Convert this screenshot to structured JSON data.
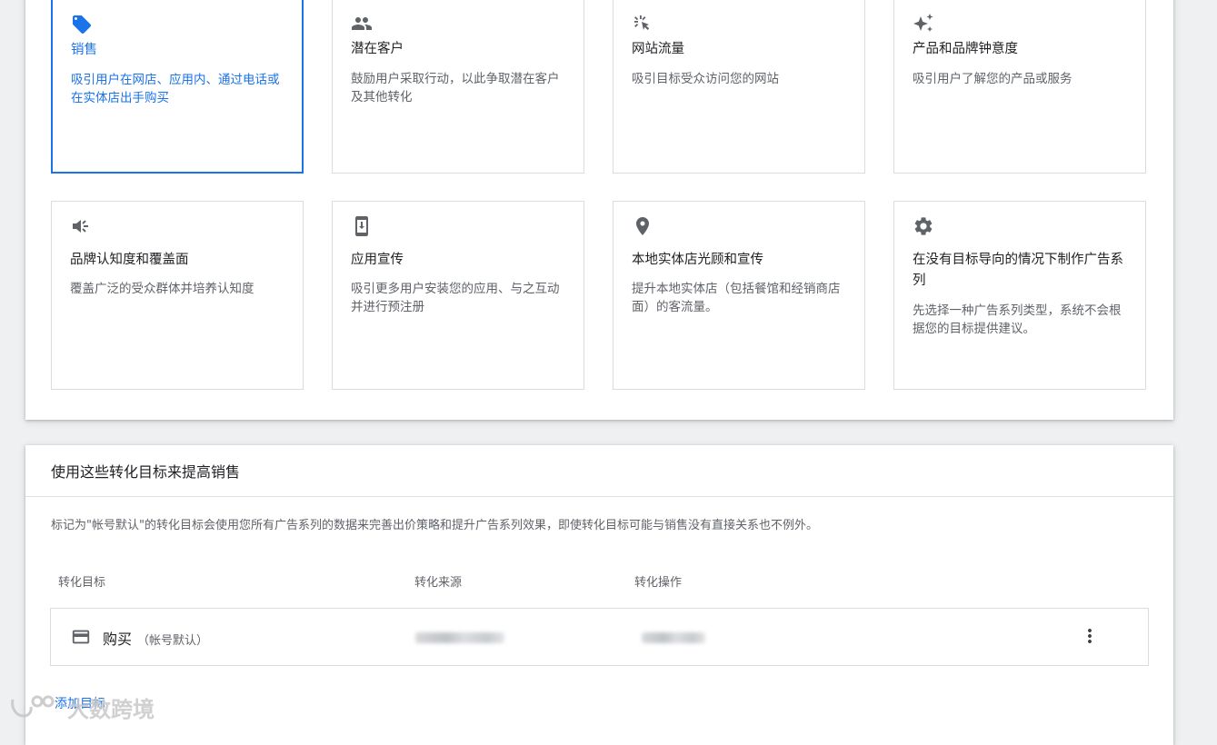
{
  "goals": [
    {
      "title": "销售",
      "desc": "吸引用户在网店、应用内、通过电话或在实体店出手购买",
      "icon": "tag-icon",
      "selected": true
    },
    {
      "title": "潜在客户",
      "desc": "鼓励用户采取行动，以此争取潜在客户及其他转化",
      "icon": "people-icon",
      "selected": false
    },
    {
      "title": "网站流量",
      "desc": "吸引目标受众访问您的网站",
      "icon": "cursor-click-icon",
      "selected": false
    },
    {
      "title": "产品和品牌钟意度",
      "desc": "吸引用户了解您的产品或服务",
      "icon": "sparkle-icon",
      "selected": false
    },
    {
      "title": "品牌认知度和覆盖面",
      "desc": "覆盖广泛的受众群体并培养认知度",
      "icon": "megaphone-icon",
      "selected": false
    },
    {
      "title": "应用宣传",
      "desc": "吸引更多用户安装您的应用、与之互动并进行预注册",
      "icon": "phone-download-icon",
      "selected": false
    },
    {
      "title": "本地实体店光顾和宣传",
      "desc": "提升本地实体店（包括餐馆和经销商店面）的客流量。",
      "icon": "location-pin-icon",
      "selected": false
    },
    {
      "title": "在没有目标导向的情况下制作广告系列",
      "desc": "先选择一种广告系列类型，系统不会根据您的目标提供建议。",
      "icon": "gear-icon",
      "selected": false
    }
  ],
  "conversion": {
    "title": "使用这些转化目标来提高销售",
    "description": "标记为\"帐号默认\"的转化目标会使用您所有广告系列的数据来完善出价策略和提升广告系列效果，即使转化目标可能与销售没有直接关系也不例外。",
    "columns": [
      "转化目标",
      "转化来源",
      "转化操作"
    ],
    "rows": [
      {
        "goal": "购买",
        "tag": "（帐号默认）",
        "icon": "credit-card-icon"
      }
    ],
    "add_label": "添加目标"
  },
  "watermark": {
    "text": "大数跨境"
  },
  "colors": {
    "accent": "#1a73e8",
    "border": "#dadce0",
    "text": "#3c4043"
  }
}
